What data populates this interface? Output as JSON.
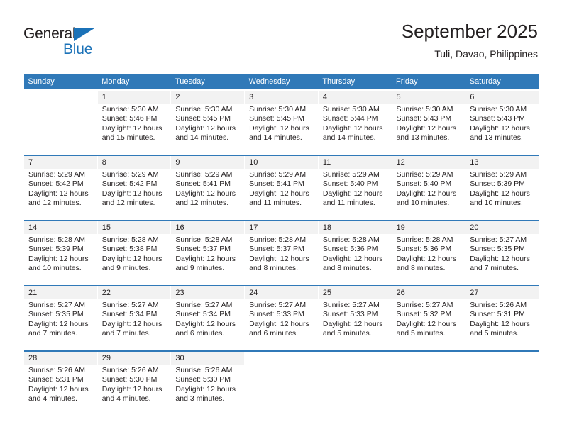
{
  "brand": {
    "name_part1": "General",
    "name_part2": "Blue",
    "accent_color": "#1b72b8"
  },
  "header": {
    "title": "September 2025",
    "subtitle": "Tuli, Davao, Philippines"
  },
  "theme": {
    "header_row_color": "#3079b8",
    "daynum_bg": "#f2f2f2",
    "text_color": "#231f20"
  },
  "weekday_headers": [
    "Sunday",
    "Monday",
    "Tuesday",
    "Wednesday",
    "Thursday",
    "Friday",
    "Saturday"
  ],
  "weeks": [
    {
      "days": [
        {
          "num": "",
          "sunrise": "",
          "sunset": "",
          "daylight1": "",
          "daylight2": ""
        },
        {
          "num": "1",
          "sunrise": "Sunrise: 5:30 AM",
          "sunset": "Sunset: 5:46 PM",
          "daylight1": "Daylight: 12 hours",
          "daylight2": "and 15 minutes."
        },
        {
          "num": "2",
          "sunrise": "Sunrise: 5:30 AM",
          "sunset": "Sunset: 5:45 PM",
          "daylight1": "Daylight: 12 hours",
          "daylight2": "and 14 minutes."
        },
        {
          "num": "3",
          "sunrise": "Sunrise: 5:30 AM",
          "sunset": "Sunset: 5:45 PM",
          "daylight1": "Daylight: 12 hours",
          "daylight2": "and 14 minutes."
        },
        {
          "num": "4",
          "sunrise": "Sunrise: 5:30 AM",
          "sunset": "Sunset: 5:44 PM",
          "daylight1": "Daylight: 12 hours",
          "daylight2": "and 14 minutes."
        },
        {
          "num": "5",
          "sunrise": "Sunrise: 5:30 AM",
          "sunset": "Sunset: 5:43 PM",
          "daylight1": "Daylight: 12 hours",
          "daylight2": "and 13 minutes."
        },
        {
          "num": "6",
          "sunrise": "Sunrise: 5:30 AM",
          "sunset": "Sunset: 5:43 PM",
          "daylight1": "Daylight: 12 hours",
          "daylight2": "and 13 minutes."
        }
      ]
    },
    {
      "days": [
        {
          "num": "7",
          "sunrise": "Sunrise: 5:29 AM",
          "sunset": "Sunset: 5:42 PM",
          "daylight1": "Daylight: 12 hours",
          "daylight2": "and 12 minutes."
        },
        {
          "num": "8",
          "sunrise": "Sunrise: 5:29 AM",
          "sunset": "Sunset: 5:42 PM",
          "daylight1": "Daylight: 12 hours",
          "daylight2": "and 12 minutes."
        },
        {
          "num": "9",
          "sunrise": "Sunrise: 5:29 AM",
          "sunset": "Sunset: 5:41 PM",
          "daylight1": "Daylight: 12 hours",
          "daylight2": "and 12 minutes."
        },
        {
          "num": "10",
          "sunrise": "Sunrise: 5:29 AM",
          "sunset": "Sunset: 5:41 PM",
          "daylight1": "Daylight: 12 hours",
          "daylight2": "and 11 minutes."
        },
        {
          "num": "11",
          "sunrise": "Sunrise: 5:29 AM",
          "sunset": "Sunset: 5:40 PM",
          "daylight1": "Daylight: 12 hours",
          "daylight2": "and 11 minutes."
        },
        {
          "num": "12",
          "sunrise": "Sunrise: 5:29 AM",
          "sunset": "Sunset: 5:40 PM",
          "daylight1": "Daylight: 12 hours",
          "daylight2": "and 10 minutes."
        },
        {
          "num": "13",
          "sunrise": "Sunrise: 5:29 AM",
          "sunset": "Sunset: 5:39 PM",
          "daylight1": "Daylight: 12 hours",
          "daylight2": "and 10 minutes."
        }
      ]
    },
    {
      "days": [
        {
          "num": "14",
          "sunrise": "Sunrise: 5:28 AM",
          "sunset": "Sunset: 5:39 PM",
          "daylight1": "Daylight: 12 hours",
          "daylight2": "and 10 minutes."
        },
        {
          "num": "15",
          "sunrise": "Sunrise: 5:28 AM",
          "sunset": "Sunset: 5:38 PM",
          "daylight1": "Daylight: 12 hours",
          "daylight2": "and 9 minutes."
        },
        {
          "num": "16",
          "sunrise": "Sunrise: 5:28 AM",
          "sunset": "Sunset: 5:37 PM",
          "daylight1": "Daylight: 12 hours",
          "daylight2": "and 9 minutes."
        },
        {
          "num": "17",
          "sunrise": "Sunrise: 5:28 AM",
          "sunset": "Sunset: 5:37 PM",
          "daylight1": "Daylight: 12 hours",
          "daylight2": "and 8 minutes."
        },
        {
          "num": "18",
          "sunrise": "Sunrise: 5:28 AM",
          "sunset": "Sunset: 5:36 PM",
          "daylight1": "Daylight: 12 hours",
          "daylight2": "and 8 minutes."
        },
        {
          "num": "19",
          "sunrise": "Sunrise: 5:28 AM",
          "sunset": "Sunset: 5:36 PM",
          "daylight1": "Daylight: 12 hours",
          "daylight2": "and 8 minutes."
        },
        {
          "num": "20",
          "sunrise": "Sunrise: 5:27 AM",
          "sunset": "Sunset: 5:35 PM",
          "daylight1": "Daylight: 12 hours",
          "daylight2": "and 7 minutes."
        }
      ]
    },
    {
      "days": [
        {
          "num": "21",
          "sunrise": "Sunrise: 5:27 AM",
          "sunset": "Sunset: 5:35 PM",
          "daylight1": "Daylight: 12 hours",
          "daylight2": "and 7 minutes."
        },
        {
          "num": "22",
          "sunrise": "Sunrise: 5:27 AM",
          "sunset": "Sunset: 5:34 PM",
          "daylight1": "Daylight: 12 hours",
          "daylight2": "and 7 minutes."
        },
        {
          "num": "23",
          "sunrise": "Sunrise: 5:27 AM",
          "sunset": "Sunset: 5:34 PM",
          "daylight1": "Daylight: 12 hours",
          "daylight2": "and 6 minutes."
        },
        {
          "num": "24",
          "sunrise": "Sunrise: 5:27 AM",
          "sunset": "Sunset: 5:33 PM",
          "daylight1": "Daylight: 12 hours",
          "daylight2": "and 6 minutes."
        },
        {
          "num": "25",
          "sunrise": "Sunrise: 5:27 AM",
          "sunset": "Sunset: 5:33 PM",
          "daylight1": "Daylight: 12 hours",
          "daylight2": "and 5 minutes."
        },
        {
          "num": "26",
          "sunrise": "Sunrise: 5:27 AM",
          "sunset": "Sunset: 5:32 PM",
          "daylight1": "Daylight: 12 hours",
          "daylight2": "and 5 minutes."
        },
        {
          "num": "27",
          "sunrise": "Sunrise: 5:26 AM",
          "sunset": "Sunset: 5:31 PM",
          "daylight1": "Daylight: 12 hours",
          "daylight2": "and 5 minutes."
        }
      ]
    },
    {
      "days": [
        {
          "num": "28",
          "sunrise": "Sunrise: 5:26 AM",
          "sunset": "Sunset: 5:31 PM",
          "daylight1": "Daylight: 12 hours",
          "daylight2": "and 4 minutes."
        },
        {
          "num": "29",
          "sunrise": "Sunrise: 5:26 AM",
          "sunset": "Sunset: 5:30 PM",
          "daylight1": "Daylight: 12 hours",
          "daylight2": "and 4 minutes."
        },
        {
          "num": "30",
          "sunrise": "Sunrise: 5:26 AM",
          "sunset": "Sunset: 5:30 PM",
          "daylight1": "Daylight: 12 hours",
          "daylight2": "and 3 minutes."
        },
        {
          "num": "",
          "sunrise": "",
          "sunset": "",
          "daylight1": "",
          "daylight2": ""
        },
        {
          "num": "",
          "sunrise": "",
          "sunset": "",
          "daylight1": "",
          "daylight2": ""
        },
        {
          "num": "",
          "sunrise": "",
          "sunset": "",
          "daylight1": "",
          "daylight2": ""
        },
        {
          "num": "",
          "sunrise": "",
          "sunset": "",
          "daylight1": "",
          "daylight2": ""
        }
      ]
    }
  ]
}
